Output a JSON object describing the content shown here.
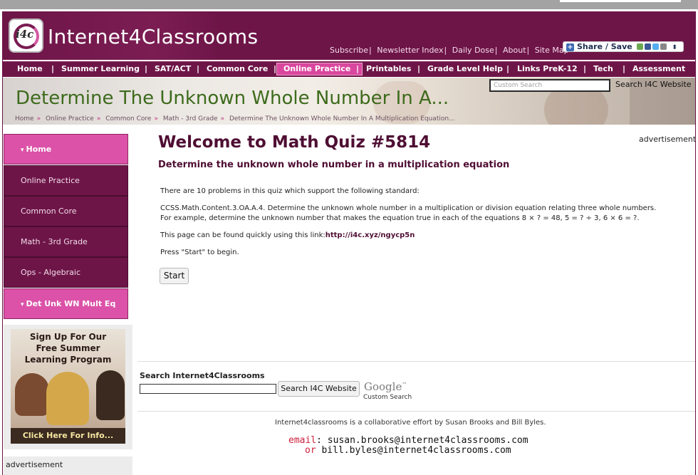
{
  "brand": {
    "logo_badge": "i4c",
    "logo_text": "Internet4Classrooms"
  },
  "top_links": [
    "Subscribe",
    "Newsletter Index",
    "Daily Dose",
    "About",
    "Site Map"
  ],
  "share": {
    "label": "Share / Save",
    "icons": [
      "plus-icon",
      "print-icon",
      "facebook-icon",
      "twitter-icon",
      "email-icon"
    ]
  },
  "nav": {
    "items": [
      "Home",
      "Summer Learning",
      "SAT/ACT",
      "Common Core",
      "Online Practice",
      "Printables",
      "Grade Level Help",
      "Links PreK-12",
      "Tech",
      "Assessment"
    ],
    "active": "Online Practice"
  },
  "banner": {
    "heading": "Determine The Unknown Whole Number In A...",
    "search_placeholder": "Custom Search",
    "search_button": "Search I4C Website",
    "breadcrumb": [
      "Home",
      "Online Practice",
      "Common Core",
      "Math - 3rd Grade",
      "Determine The Unknown Whole Number In A Multiplication Equation..."
    ]
  },
  "sidebar": {
    "items": [
      {
        "label": "Home",
        "highlight": true
      },
      {
        "label": "Online Practice",
        "highlight": false
      },
      {
        "label": "Common Core",
        "highlight": false
      },
      {
        "label": "Math - 3rd Grade",
        "highlight": false
      },
      {
        "label": "Ops - Algebraic",
        "highlight": false
      },
      {
        "label": "Det Unk WN Mult Eq",
        "highlight": true
      }
    ],
    "promo": {
      "headline_1": "Sign Up For Our",
      "headline_2": "Free Summer",
      "headline_3": "Learning Program",
      "footer": "Click Here For Info..."
    },
    "advertisement": "advertisement"
  },
  "main": {
    "title": "Welcome to Math Quiz #5814",
    "advertisement": "advertisement",
    "subtitle": "Determine the unknown whole number in a multiplication equation",
    "intro": "There are 10 problems in this quiz which support the following standard:",
    "standard_1": "CCSS.Math.Content.3.OA.A.4. Determine the unknown whole number in a multiplication or division equation relating three whole numbers.",
    "standard_2": "For example, determine the unknown number that makes the equation true in each of the equations 8 × ? = 48, 5 = ? ÷ 3, 6 × 6 = ?.",
    "link_prefix": "This page can be found quickly using this link:",
    "link_url": "http://i4c.xyz/ngycp5n",
    "press_start": "Press \"Start\" to begin.",
    "start_button": "Start"
  },
  "footer": {
    "search_heading": "Search Internet4Classrooms",
    "search_button": "Search I4C Website",
    "google_logo": "Google",
    "google_sub": "Custom Search",
    "collab_text": "Internet4classrooms is a collaborative effort by Susan Brooks and Bill Byles.",
    "email_label": "email",
    "email_1": "susan.brooks@internet4classrooms.com",
    "or_label": "or",
    "email_2": "bill.byles@internet4classrooms.com"
  }
}
